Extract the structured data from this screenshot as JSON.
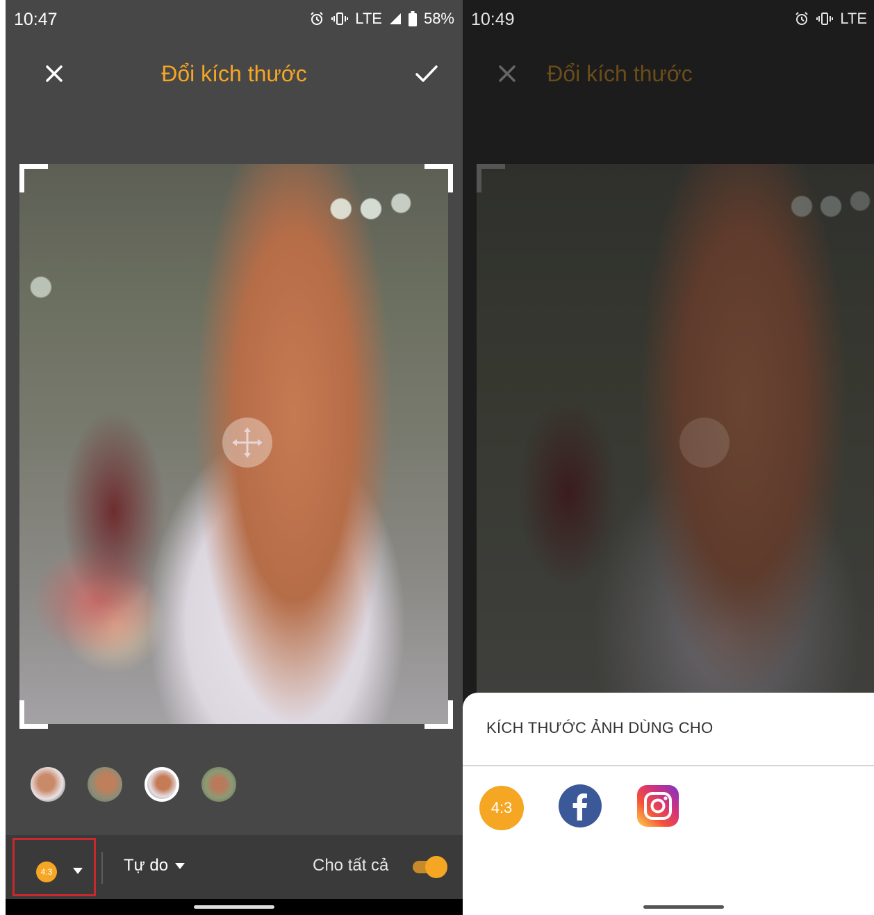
{
  "left": {
    "status": {
      "time": "10:47",
      "network": "LTE",
      "battery": "58%"
    },
    "toolbar": {
      "title": "Đổi kích thước"
    },
    "bottom": {
      "ratio_label": "4:3",
      "free_label": "Tự do",
      "apply_all_label": "Cho tất cả",
      "apply_all_on": true
    }
  },
  "right": {
    "status": {
      "time": "10:49",
      "network": "LTE"
    },
    "toolbar": {
      "title": "Đổi kích thước"
    },
    "sheet": {
      "title": "KÍCH THƯỚC ẢNH DÙNG CHO",
      "option_ratio_label": "4:3"
    }
  },
  "colors": {
    "accent": "#f5a623",
    "highlight": "#c8282e",
    "facebook": "#3b5998"
  },
  "icons": [
    "close-icon",
    "check-icon",
    "move-icon",
    "caret-down-icon",
    "alarm-icon",
    "vibrate-icon",
    "signal-icon",
    "battery-icon",
    "facebook-icon",
    "instagram-icon"
  ]
}
